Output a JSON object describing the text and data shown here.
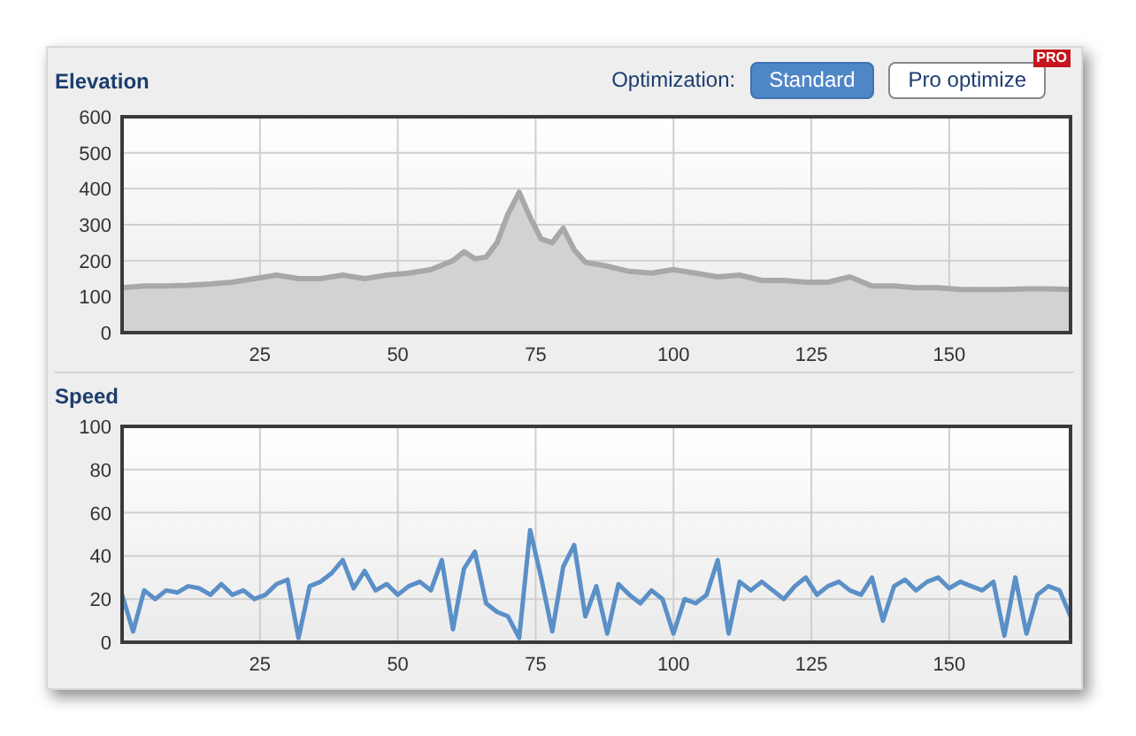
{
  "elevation": {
    "optimization": {
      "label": "Optimization:",
      "options": [
        {
          "label": "Standard",
          "selected": true
        },
        {
          "label": "Pro optimize",
          "selected": false,
          "badge": "PRO"
        }
      ]
    },
    "chart_data": {
      "type": "area",
      "title": "Elevation",
      "grid": true,
      "xlim": [
        0,
        172
      ],
      "ylim": [
        0,
        600
      ],
      "xticks": [
        25,
        50,
        75,
        100,
        125,
        150
      ],
      "yticks": [
        0,
        100,
        200,
        300,
        400,
        500,
        600
      ],
      "x": [
        0,
        4,
        8,
        12,
        16,
        20,
        24,
        28,
        32,
        36,
        40,
        44,
        48,
        52,
        56,
        60,
        62,
        64,
        66,
        68,
        70,
        72,
        74,
        76,
        78,
        80,
        82,
        84,
        88,
        92,
        96,
        100,
        104,
        108,
        112,
        116,
        120,
        124,
        128,
        132,
        136,
        140,
        144,
        148,
        152,
        156,
        160,
        164,
        168,
        172
      ],
      "series": [
        {
          "color": "#a8a8a8",
          "values": [
            125,
            130,
            130,
            132,
            135,
            140,
            150,
            160,
            150,
            150,
            160,
            150,
            160,
            165,
            175,
            200,
            225,
            205,
            210,
            250,
            330,
            390,
            320,
            260,
            250,
            290,
            230,
            195,
            185,
            170,
            165,
            175,
            165,
            155,
            160,
            145,
            145,
            140,
            140,
            155,
            130,
            130,
            125,
            125,
            120,
            120,
            120,
            122,
            122,
            120
          ]
        }
      ]
    }
  },
  "speed": {
    "chart_data": {
      "type": "line",
      "title": "Speed",
      "grid": true,
      "xlim": [
        0,
        172
      ],
      "ylim": [
        0,
        100
      ],
      "xticks": [
        25,
        50,
        75,
        100,
        125,
        150
      ],
      "yticks": [
        0,
        20,
        40,
        60,
        80,
        100
      ],
      "x": [
        0,
        2,
        4,
        6,
        8,
        10,
        12,
        14,
        16,
        18,
        20,
        22,
        24,
        26,
        28,
        30,
        32,
        34,
        36,
        38,
        40,
        42,
        44,
        46,
        48,
        50,
        52,
        54,
        56,
        58,
        60,
        62,
        64,
        66,
        68,
        70,
        72,
        74,
        76,
        78,
        80,
        82,
        84,
        86,
        88,
        90,
        92,
        94,
        96,
        98,
        100,
        102,
        104,
        106,
        108,
        110,
        112,
        114,
        116,
        118,
        120,
        122,
        124,
        126,
        128,
        130,
        132,
        134,
        136,
        138,
        140,
        142,
        144,
        146,
        148,
        150,
        152,
        154,
        156,
        158,
        160,
        162,
        164,
        166,
        168,
        170,
        172
      ],
      "series": [
        {
          "color": "#5b8fc7",
          "values": [
            22,
            5,
            24,
            20,
            24,
            23,
            26,
            25,
            22,
            27,
            22,
            24,
            20,
            22,
            27,
            29,
            2,
            26,
            28,
            32,
            38,
            25,
            33,
            24,
            27,
            22,
            26,
            28,
            24,
            38,
            6,
            34,
            42,
            18,
            14,
            12,
            2,
            52,
            30,
            5,
            35,
            45,
            12,
            26,
            4,
            27,
            22,
            18,
            24,
            20,
            4,
            20,
            18,
            22,
            38,
            4,
            28,
            24,
            28,
            24,
            20,
            26,
            30,
            22,
            26,
            28,
            24,
            22,
            30,
            10,
            26,
            29,
            24,
            28,
            30,
            25,
            28,
            26,
            24,
            28,
            3,
            30,
            4,
            22,
            26,
            24,
            12
          ]
        }
      ]
    }
  }
}
